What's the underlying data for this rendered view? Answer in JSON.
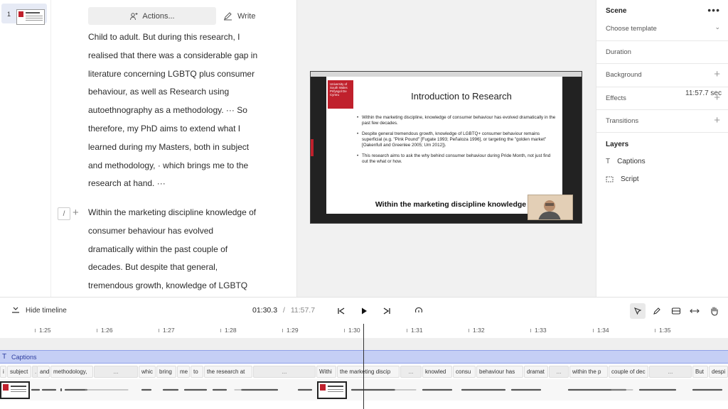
{
  "scenes_list": {
    "items": [
      {
        "number": "1"
      }
    ]
  },
  "script": {
    "actions_label": "Actions...",
    "write_label": "Write",
    "paragraph1": [
      "Child to adult. But during this research, I",
      "realised that there was a considerable gap in",
      "literature concerning LGBTQ plus consumer",
      "behaviour, as well as Research using",
      "autoethnography as a methodology. ··· So",
      "therefore, my PhD aims to extend what I",
      "learned during my Masters, both in subject",
      "and methodology, · which brings me to the",
      "research at hand. ···"
    ],
    "paragraph2": [
      "Within the marketing discipline knowledge of",
      "consumer behaviour has evolved",
      "dramatically within the past couple of",
      "decades. But despite that general,",
      "tremendous growth, knowledge of LGBTQ"
    ],
    "slash_label": "/",
    "plus_label": "+"
  },
  "slide": {
    "logo_text": "University of South Wales Prifysgol De Cymru",
    "title": "Introduction to Research",
    "bullets": [
      "Within the marketing discipline, knowledge of consumer behaviour has evolved dramatically in the past few decades.",
      "Despite general tremendous growth, knowledge of LGBTQ+ consumer behaviour remains superficial (e.g. \"Pink Pound\" [Fugate 1993; Peñaloza 1996], or targeting the \"golden market\" [Oakenfull and Greenlee 2005; Um 2012]).",
      "This research aims to ask the why behind consumer behaviour during Pride Month, not just find out the what or how."
    ],
    "caption": "Within the marketing discipline knowledge"
  },
  "panel": {
    "scene_title": "Scene",
    "more_label": "•••",
    "template_label": "Choose template",
    "duration_label": "Duration",
    "duration_value": "11:57.7 sec",
    "background_label": "Background",
    "effects_label": "Effects",
    "transitions_label": "Transitions",
    "layers_title": "Layers",
    "layers": [
      {
        "label": "Captions",
        "icon": "T"
      },
      {
        "label": "Script",
        "icon": "script-icon"
      }
    ]
  },
  "toolbar": {
    "hide_timeline": "Hide timeline",
    "current_time": "01:30.3",
    "separator": "/",
    "total_time": "11:57.7"
  },
  "timeline": {
    "ticks": [
      "1:25",
      "1:26",
      "1:27",
      "1:28",
      "1:29",
      "1:30",
      "1:31",
      "1:32",
      "1:33",
      "1:34",
      "1:35"
    ],
    "captions_track_label": "Captions",
    "words": [
      "i",
      "subject",
      "...",
      "and",
      "methodology,",
      "...",
      "whic",
      "bring",
      "me",
      "to",
      "the research at",
      "...",
      "Withi",
      "the marketing discip",
      "...",
      "knowled",
      "consu",
      "behaviour has",
      "dramat",
      "...",
      "within the p",
      "couple of dec",
      "...",
      "But",
      "despi"
    ]
  }
}
